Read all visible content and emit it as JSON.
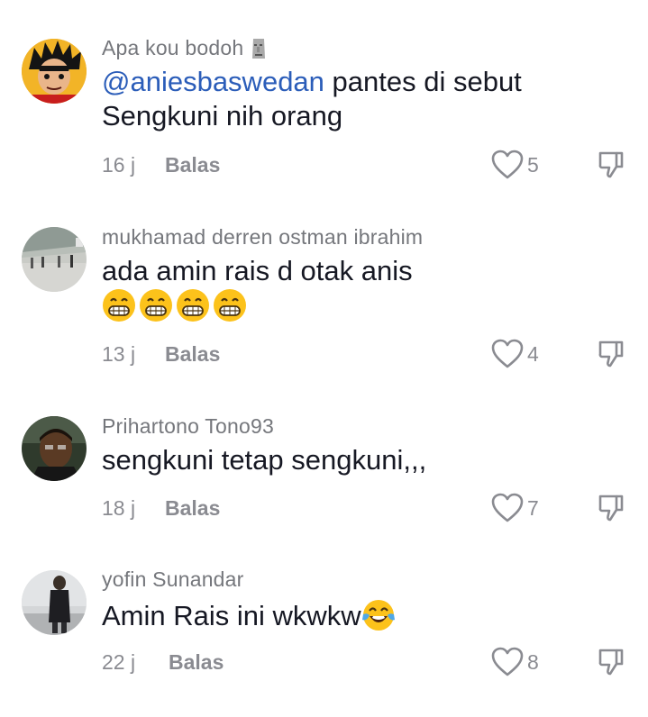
{
  "comments": [
    {
      "username": "Apa kou bodoh",
      "mention": "@aniesbaswedan",
      "text_line1": " pantes di sebut",
      "text_line2": "Sengkuni nih orang",
      "time": "16 j",
      "reply_label": "Balas",
      "likes": "5",
      "avatar_icon": "anime-character-avatar",
      "username_emoji": "moai-icon"
    },
    {
      "username": "mukhamad derren ostman ibrahim",
      "text": "ada amin rais d otak anis",
      "emojis": [
        "grinning-face-icon",
        "grinning-face-icon",
        "grinning-face-icon",
        "grinning-face-icon"
      ],
      "time": "13 j",
      "reply_label": "Balas",
      "likes": "4",
      "avatar_icon": "station-photo-avatar"
    },
    {
      "username": "Prihartono Tono93",
      "text": "sengkuni tetap sengkuni,,,",
      "time": "18 j",
      "reply_label": "Balas",
      "likes": "7",
      "avatar_icon": "man-photo-avatar"
    },
    {
      "username": "yofin Sunandar",
      "text": "Amin Rais ini wkwkw",
      "text_emoji": "tears-of-joy-icon",
      "time": "22 j",
      "reply_label": "Balas",
      "likes": "8",
      "avatar_icon": "person-photo-avatar"
    }
  ],
  "colors": {
    "mention": "#2b5db9",
    "username": "#75777c",
    "meta": "#8a8b91",
    "text": "#161823"
  }
}
